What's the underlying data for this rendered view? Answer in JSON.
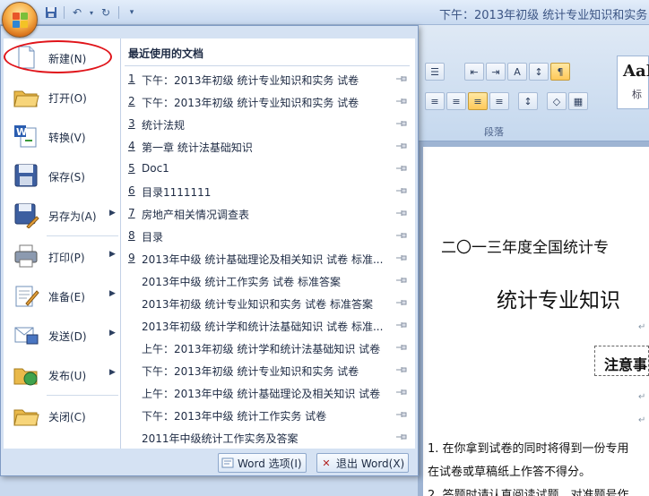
{
  "window": {
    "title": "下午：2013年初级 统计专业知识和实务 试"
  },
  "quick_access": {
    "save_icon": "save-icon",
    "undo_icon": "undo-icon",
    "redo_icon": "redo-icon"
  },
  "ribbon": {
    "paragraph_label": "段落",
    "style_preview": "AaI",
    "style_sub": "标"
  },
  "menu": {
    "commands": [
      {
        "label": "新建(N)",
        "icon": "new-document-icon",
        "submenu": false
      },
      {
        "label": "打开(O)",
        "icon": "open-folder-icon",
        "submenu": false
      },
      {
        "label": "转换(V)",
        "icon": "convert-icon",
        "submenu": false
      },
      {
        "label": "保存(S)",
        "icon": "save-disk-icon",
        "submenu": false
      },
      {
        "label": "另存为(A)",
        "icon": "save-as-icon",
        "submenu": true
      },
      {
        "label": "打印(P)",
        "icon": "printer-icon",
        "submenu": true
      },
      {
        "label": "准备(E)",
        "icon": "prepare-icon",
        "submenu": true
      },
      {
        "label": "发送(D)",
        "icon": "send-icon",
        "submenu": true
      },
      {
        "label": "发布(U)",
        "icon": "publish-icon",
        "submenu": true
      },
      {
        "label": "关闭(C)",
        "icon": "close-folder-icon",
        "submenu": false
      }
    ],
    "recent_title": "最近使用的文档",
    "recent": [
      {
        "num": "1",
        "name": "下午：2013年初级 统计专业知识和实务 试卷"
      },
      {
        "num": "2",
        "name": "下午：2013年初级 统计专业知识和实务 试卷"
      },
      {
        "num": "3",
        "name": "统计法规"
      },
      {
        "num": "4",
        "name": "第一章 统计法基础知识"
      },
      {
        "num": "5",
        "name": "Doc1"
      },
      {
        "num": "6",
        "name": "目录1111111"
      },
      {
        "num": "7",
        "name": "房地产相关情况调查表"
      },
      {
        "num": "8",
        "name": "目录"
      },
      {
        "num": "9",
        "name": "2013年中级 统计基础理论及相关知识 试卷 标准..."
      },
      {
        "num": "",
        "name": "2013年中级 统计工作实务 试卷 标准答案"
      },
      {
        "num": "",
        "name": "2013年初级 统计专业知识和实务 试卷 标准答案"
      },
      {
        "num": "",
        "name": "2013年初级 统计学和统计法基础知识 试卷 标准..."
      },
      {
        "num": "",
        "name": "上午：2013年初级 统计学和统计法基础知识 试卷"
      },
      {
        "num": "",
        "name": "下午：2013年初级 统计专业知识和实务 试卷"
      },
      {
        "num": "",
        "name": "上午：2013年中级 统计基础理论及相关知识 试卷"
      },
      {
        "num": "",
        "name": "下午：2013年中级 统计工作实务 试卷"
      },
      {
        "num": "",
        "name": "2011年中级统计工作实务及答案"
      }
    ],
    "word_options_label": "Word 选项(I)",
    "exit_word_label": "退出 Word(X)"
  },
  "document": {
    "line1": "二〇一三年度全国统计专",
    "title": "统计专业知识",
    "box_label": "注意事",
    "item1": "1.  在你拿到试卷的同时将得到一份专用",
    "item1b": "在试卷或草稿纸上作答不得分。",
    "item2": "2.  答题时请认真阅读试题，对准题号作"
  }
}
